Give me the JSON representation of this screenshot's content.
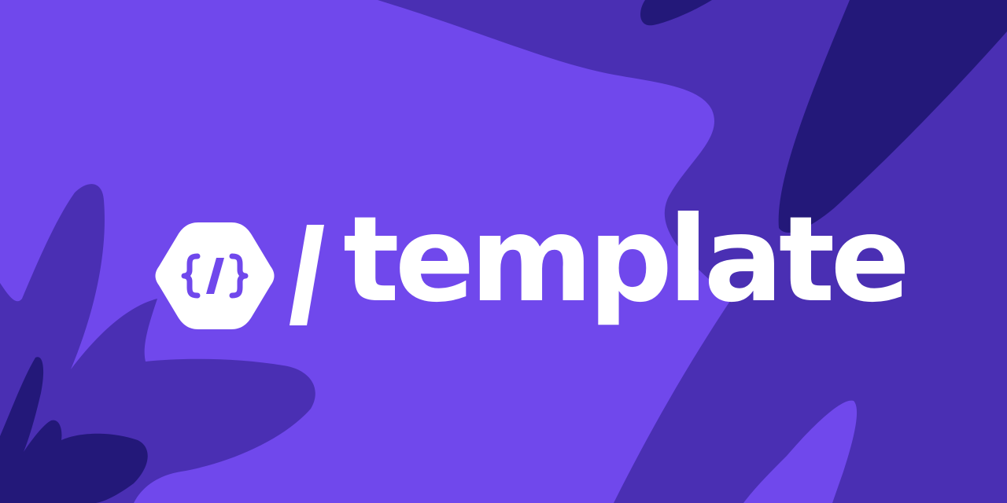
{
  "brand": {
    "wordmark": "template",
    "logo_icon": "code-braces-hexagon-icon",
    "separator_icon": "slash-icon"
  },
  "colors": {
    "background": "#7048ec",
    "blob_mid": "#4a2fb3",
    "blob_dark": "#231879",
    "foreground": "#ffffff"
  }
}
